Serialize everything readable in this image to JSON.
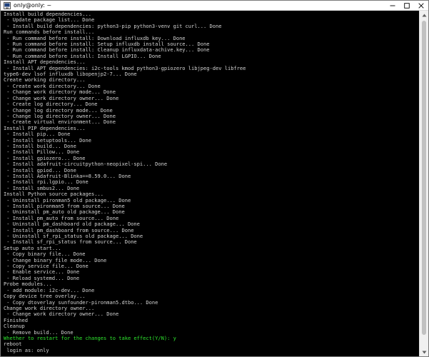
{
  "window": {
    "title": "only@only: ~",
    "icon": "terminal-icon"
  },
  "colors": {
    "terminal_bg": "#000000",
    "terminal_text": "#d3d3d3",
    "prompt_green": "#2ee62e",
    "titlebar_bg": "#ffffff"
  },
  "terminal": {
    "lines": [
      {
        "text": "Install build dependencies...",
        "color": "normal"
      },
      {
        "text": " - Update package list... Done",
        "color": "normal"
      },
      {
        "text": " - Install build dependencies: python3-pip python3-venv git curl... Done",
        "color": "normal"
      },
      {
        "text": "Run commands before install...",
        "color": "normal"
      },
      {
        "text": " - Run command before install: Download influxdb key... Done",
        "color": "normal"
      },
      {
        "text": " - Run command before install: Setup influxdb install source... Done",
        "color": "normal"
      },
      {
        "text": " - Run command before install: Cleanup influxdata-achive.key... Done",
        "color": "normal"
      },
      {
        "text": " - Run command before install: Install LGPIO... Done",
        "color": "normal"
      },
      {
        "text": "Install APT dependencies...",
        "color": "normal"
      },
      {
        "text": " - Install APT dependencies: i2c-tools kmod python3-gpiozero libjpeg-dev libfree",
        "color": "normal"
      },
      {
        "text": "type6-dev lsof influxdb libopenjp2-7... Done",
        "color": "normal"
      },
      {
        "text": "Create working directory...",
        "color": "normal"
      },
      {
        "text": " - Create work directory... Done",
        "color": "normal"
      },
      {
        "text": " - Change work directory mode... Done",
        "color": "normal"
      },
      {
        "text": " - Change work directory owner... Done",
        "color": "normal"
      },
      {
        "text": " - Create log directory... Done",
        "color": "normal"
      },
      {
        "text": " - Change log directory mode... Done",
        "color": "normal"
      },
      {
        "text": " - Change log directory owner... Done",
        "color": "normal"
      },
      {
        "text": " - Create virtual environment... Done",
        "color": "normal"
      },
      {
        "text": "Install PIP dependencies...",
        "color": "normal"
      },
      {
        "text": " - Install pip... Done",
        "color": "normal"
      },
      {
        "text": " - Install setuptools... Done",
        "color": "normal"
      },
      {
        "text": " - Install build... Done",
        "color": "normal"
      },
      {
        "text": " - Install Pillow... Done",
        "color": "normal"
      },
      {
        "text": " - Install gpiozero... Done",
        "color": "normal"
      },
      {
        "text": " - Install adafruit-circuitpython-neopixel-spi... Done",
        "color": "normal"
      },
      {
        "text": " - Install gpiod... Done",
        "color": "normal"
      },
      {
        "text": " - Install Adafruit-Blinka==8.59.0... Done",
        "color": "normal"
      },
      {
        "text": " - Install rpi.lgpio... Done",
        "color": "normal"
      },
      {
        "text": " - Install smbus2... Done",
        "color": "normal"
      },
      {
        "text": "Install Python source packages...",
        "color": "normal"
      },
      {
        "text": " - Uninstall pironman5 old package... Done",
        "color": "normal"
      },
      {
        "text": " - Install pironman5 from source... Done",
        "color": "normal"
      },
      {
        "text": " - Uninstall pm_auto old package... Done",
        "color": "normal"
      },
      {
        "text": " - Install pm_auto from source... Done",
        "color": "normal"
      },
      {
        "text": " - Uninstall pm_dashboard old package... Done",
        "color": "normal"
      },
      {
        "text": " - Install pm_dashboard from source... Done",
        "color": "normal"
      },
      {
        "text": " - Uninstall sf_rpi_status old package... Done",
        "color": "normal"
      },
      {
        "text": " - Install sf_rpi_status from source... Done",
        "color": "normal"
      },
      {
        "text": "Setup auto start...",
        "color": "normal"
      },
      {
        "text": " - Copy binary file... Done",
        "color": "normal"
      },
      {
        "text": " - Change binary file mode... Done",
        "color": "normal"
      },
      {
        "text": " - Copy service file... Done",
        "color": "normal"
      },
      {
        "text": " - Enable service... Done",
        "color": "normal"
      },
      {
        "text": " - Reload systemd... Done",
        "color": "normal"
      },
      {
        "text": "Probe modules...",
        "color": "normal"
      },
      {
        "text": " - add module: i2c-dev... Done",
        "color": "normal"
      },
      {
        "text": "Copy device tree overlay...",
        "color": "normal"
      },
      {
        "text": " - Copy dtoverlay sunfounder-pironman5.dtbo... Done",
        "color": "normal"
      },
      {
        "text": "Change work directory owner...",
        "color": "normal"
      },
      {
        "text": " - Change work directory owner... Done",
        "color": "normal"
      },
      {
        "text": "Finished",
        "color": "normal"
      },
      {
        "text": "Cleanup",
        "color": "normal"
      },
      {
        "text": " - Remove build... Done",
        "color": "normal"
      },
      {
        "text": "Whether to restart for the changes to take effect(Y/N): y",
        "color": "green"
      },
      {
        "text": "reboot",
        "color": "normal"
      },
      {
        "text": " login as: only",
        "color": "normal"
      }
    ]
  }
}
